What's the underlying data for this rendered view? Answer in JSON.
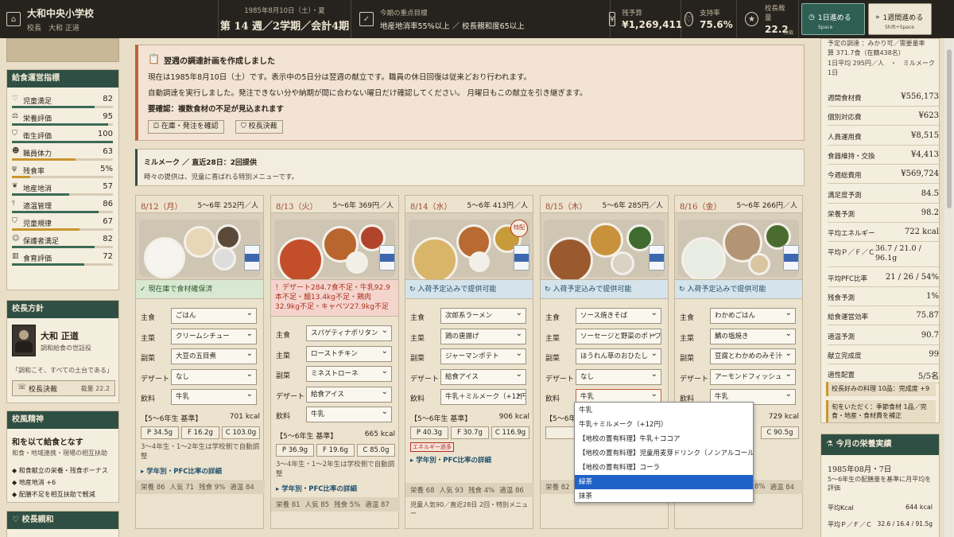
{
  "header": {
    "school_name": "大和中央小学校",
    "principal": "校長　大和 正道",
    "date_line": "1985年8月10日（土）・夏",
    "week_line": "第 14 週／2学期／会計4期",
    "goal_label": "今期の重点目標",
    "goal_text": "地産地消率55%以上 ／ 校長親和度65以上",
    "budget_label": "残予算",
    "budget_value": "¥1,269,411",
    "support_label": "支持率",
    "support_value": "75.6%",
    "discretion_label": "校長裁量",
    "discretion_value": "22.2",
    "discretion_badge": "決裁",
    "advance_day_label": "1日進める",
    "advance_day_key": "Space",
    "advance_week_label": "1週間進める",
    "advance_week_key": "Shift+Space"
  },
  "metrics": {
    "title": "給食運営指標",
    "items": [
      {
        "icon": "heart-icon",
        "glyph": "♡",
        "label": "児童満足",
        "value": "82",
        "level": 0.82,
        "warn": false
      },
      {
        "icon": "scale-icon",
        "glyph": "⚖",
        "label": "栄養評価",
        "value": "95",
        "level": 0.95,
        "warn": false
      },
      {
        "icon": "shield-icon",
        "glyph": "⛉",
        "label": "衛生評価",
        "value": "100",
        "level": 1.0,
        "warn": false
      },
      {
        "icon": "staff-icon",
        "glyph": "☻",
        "label": "職員体力",
        "value": "63",
        "level": 0.63,
        "warn": true
      },
      {
        "icon": "waste-icon",
        "glyph": "ψ",
        "label": "残食率",
        "value": "5%",
        "level": 0.18,
        "warn": true
      },
      {
        "icon": "leaf-icon",
        "glyph": "❦",
        "label": "地産地消",
        "value": "57",
        "level": 0.57,
        "warn": false
      },
      {
        "icon": "thermometer-icon",
        "glyph": "⫯",
        "label": "適温管理",
        "value": "86",
        "level": 0.86,
        "warn": false
      },
      {
        "icon": "shield-check-icon",
        "glyph": "⛉",
        "label": "児童規律",
        "value": "67",
        "level": 0.67,
        "warn": true
      },
      {
        "icon": "parents-icon",
        "glyph": "☺",
        "label": "保護者満足",
        "value": "82",
        "level": 0.82,
        "warn": false
      },
      {
        "icon": "book-icon",
        "glyph": "▥",
        "label": "食育評価",
        "value": "72",
        "level": 0.72,
        "warn": false
      }
    ]
  },
  "policy": {
    "title": "校長方針",
    "name": "大和 正道",
    "subtitle": "調和給食の世話役",
    "quote": "「調和こそ、すべての土台である」",
    "button": "校長決裁",
    "discretion": "裁量 22.2"
  },
  "spirit": {
    "title": "校風精神",
    "headline": "和を以て給食となす",
    "desc": "和食・地域連携・現場の相互扶助",
    "bullets": [
      "和食献立の栄養・残食ボーナス",
      "地産地消 +6",
      "配膳不足を相互扶助で軽減"
    ]
  },
  "affinity": {
    "title": "校長親和"
  },
  "notice": {
    "title": "翌週の調達計画を作成しました",
    "line1": "現在は1985年8月10日（土）です。表示中の5日分は翌週の献立です。職員の休日回復は従来どおり行われます。",
    "line2": "自動調達を実行しました。発注できない分や納期が間に合わない曜日だけ確認してください。 月曜日もこの献立を引き継ぎます。",
    "warning": "要確認：複数食材の不足が見込まれます",
    "btn_stock": "在庫・発注を確認",
    "btn_decide": "校長決裁"
  },
  "milmake": {
    "title": "ミルメーク ／ 直近28日：2回提供",
    "desc": "時々の提供は、児童に喜ばれる特別メニューです。"
  },
  "field_labels": {
    "staple": "主食",
    "main": "主菜",
    "side": "副菜",
    "dessert": "デザート",
    "drink": "飲料"
  },
  "days": [
    {
      "date": "8/12（月）",
      "price": "5〜6年 252円／人",
      "status": "✓ 現在庫で食材確保済",
      "status_type": "ok",
      "staple": "ごはん",
      "main": "クリームシチュー",
      "side": "大豆の五目煮",
      "dessert": "なし",
      "drink": "牛乳",
      "nutrition_label": "【5〜6年生 基準】",
      "kcal": "701 kcal",
      "p": "P 34.5g",
      "f": "F 16.2g",
      "c": "C 103.0g",
      "note": "3〜4年生・1〜2年生は学校側で自動調整",
      "link": "▸ 学年別・PFC比率の詳細",
      "scores": [
        "栄養 86",
        "人気 71",
        "残食 9%",
        "適温 84"
      ]
    },
    {
      "date": "8/13（火）",
      "price": "5〜6年 369円／人",
      "status": "！デザート284.7食不足・牛乳92.9本不足・麺13.4kg不足・鶏肉32.9kg不足・キャベツ27.9kg不足",
      "status_type": "ng",
      "staple": "スパゲティナポリタン",
      "main": "ローストチキン",
      "side": "ミネストローネ",
      "dessert": "給食アイス",
      "drink": "牛乳",
      "nutrition_label": "【5〜6年生 基準】",
      "kcal": "665 kcal",
      "p": "P 36.9g",
      "f": "F 19.6g",
      "c": "C 85.0g",
      "note": "3〜4年生・1〜2年生は学校側で自動調整",
      "link": "▸ 学年別・PFC比率の詳細",
      "scores": [
        "栄養 81",
        "人気 85",
        "残食 5%",
        "適温 87"
      ]
    },
    {
      "date": "8/14（水）",
      "price": "5〜6年 413円／人",
      "status": "↻ 入荷予定込みで提供可能",
      "status_type": "in",
      "staple": "次郎系ラーメン",
      "main": "鶏の唐揚げ",
      "side": "ジャーマンポテト",
      "dessert": "給食アイス",
      "drink": "牛乳＋ミルメーク（+12円）",
      "nutrition_label": "【5〜6年生 基準】",
      "kcal": "906 kcal",
      "p": "P 40.3g",
      "f": "F 30.7g",
      "c": "C 116.9g",
      "energy_badge": "エネルギー過多",
      "link": "▸ 学年別・PFC比率の詳細",
      "scores": [
        "栄養 68",
        "人気 93",
        "残食 4%",
        "適温 86"
      ],
      "extra": "児童人気90／直近28日 2回・特別メニュー",
      "special": "特配"
    },
    {
      "date": "8/15（木）",
      "price": "5〜6年 285円／人",
      "status": "↻ 入荷予定込みで提供可能",
      "status_type": "in",
      "staple": "ソース焼きそば",
      "main": "ソーセージと野菜のポトフ",
      "side": "ほうれん草のおひたし",
      "dessert": "なし",
      "drink": "牛乳",
      "nutrition_label": "【5〜6年生 基準】",
      "p": "P 32.3g",
      "score_first": "栄養 82"
    },
    {
      "date": "8/16（金）",
      "price": "5〜6年 266円／人",
      "status": "↻ 入荷予定込みで提供可能",
      "status_type": "in",
      "staple": "わかめごはん",
      "main": "鯖の塩焼き",
      "side": "豆腐とわかめのみそ汁",
      "dessert": "アーモンドフィッシュ",
      "drink": "牛乳",
      "kcal": "729 kcal",
      "c": "C 90.5g",
      "score_tail": "8%",
      "score_last": "適温 84"
    }
  ],
  "dropdown": {
    "options": [
      "牛乳",
      "牛乳＋ミルメーク（+12円）",
      "【地校の置有料理】牛乳＋ココア",
      "【地校の置有料理】児童用麦芽ドリンク（ノンアルコール）",
      "【地校の置有料理】コーラ",
      "緑茶",
      "抹茶"
    ],
    "highlighted_index": 5
  },
  "right": {
    "top1": "予定の調達 ：みかり可／需要量率",
    "top2": "算 371.7食（在籍438名）",
    "top3": "1日平均 295円／人　・　ミルメーク 1日",
    "rows": [
      {
        "label": "週間食材費",
        "value": "¥556,173"
      },
      {
        "label": "個別対応費",
        "value": "¥623"
      },
      {
        "label": "人員運用費",
        "value": "¥8,515"
      },
      {
        "label": "食器維持・交換",
        "value": "¥4,413"
      },
      {
        "label": "今週総費用",
        "value": "¥569,724"
      },
      {
        "label": "満足度予測",
        "value": "84.5"
      },
      {
        "label": "栄養予測",
        "value": "98.2"
      },
      {
        "label": "平均エネルギー",
        "value": "722 kcal"
      },
      {
        "label": "平均Ｐ／Ｆ／Ｃ",
        "value": "36.7 / 21.0 / 96.1g"
      },
      {
        "label": "平均PFC比率",
        "value": "21 / 26 / 54%"
      },
      {
        "label": "残食予測",
        "value": "1%"
      },
      {
        "label": "給食運営効率",
        "value": "75.87"
      },
      {
        "label": "適温予測",
        "value": "90.7"
      },
      {
        "label": "献立完成度",
        "value": "99"
      },
      {
        "label": "適性配置",
        "value": "5/5名"
      }
    ],
    "note1": "校長好みの料理 10品：完成度 +9",
    "note2": "旬をいただく：季節食材 1品／完食・地産・食材費を補正",
    "results_title": "今月の栄養実績",
    "results_date": "1985年08月・7日",
    "results_desc": "5〜6年生の配膳量を基準に月平均を評価",
    "res1_label": "平均Kcal",
    "res1_value": "644 kcal",
    "res2_label": "平均Ｐ／Ｆ／Ｃ",
    "res2_value": "32.6 / 16.4 / 91.5g"
  },
  "colors": {
    "header": "#26231f",
    "accent": "#2f4f44",
    "alert": "#c0633a",
    "highlight": "#1e62c8"
  }
}
